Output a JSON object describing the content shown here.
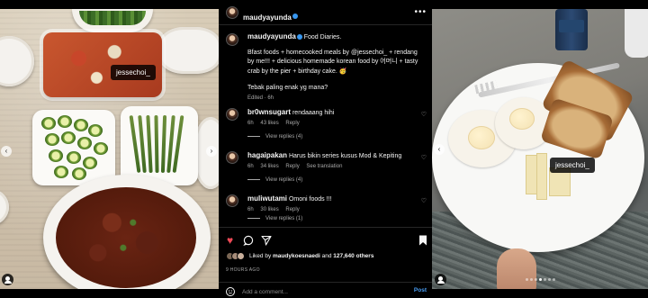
{
  "post": {
    "author": "maudyayunda",
    "caption_author": "maudyayunda",
    "caption_title": "Food Diaries.",
    "caption_body_1": "Bfast foods + homecooked meals by @jessechoi_ + rendang by me!!! + delicious homemade korean food by 어머니 + tasty crab by the pier + birthday cake. 🥳",
    "caption_body_2": "Tebak paling enak yg mana?",
    "caption_edited": "Edited · 6h",
    "more_icon": "•••"
  },
  "left_photo": {
    "tag": "jessechoi_",
    "prev_arrow": "‹",
    "next_arrow": "›"
  },
  "right_photo": {
    "tag": "jessechoi_",
    "prev_arrow": "‹"
  },
  "comments": [
    {
      "user": "br0wnsugart",
      "text": "rendaaang hihi",
      "time": "6h",
      "likes": "43 likes",
      "reply": "Reply",
      "replies": "View replies (4)"
    },
    {
      "user": "hagaipakan",
      "text": "Harus bikin series kusus Mod & Kepiting",
      "time": "6h",
      "likes": "34 likes",
      "reply": "Reply",
      "translation": "See translation",
      "replies": "View replies (4)"
    },
    {
      "user": "muliwutami",
      "text": "Omoni foods !!!",
      "time": "6h",
      "likes": "30 likes",
      "reply": "Reply",
      "replies": "View replies (1)"
    }
  ],
  "likes": {
    "prefix": "Liked by",
    "user": "maudykoesnaedi",
    "middle": "and",
    "count": "127,640 others"
  },
  "time_ago": "9 HOURS AGO",
  "add_comment": {
    "placeholder": "Add a comment...",
    "post_label": "Post"
  },
  "colors": {
    "accent": "#3897f0",
    "like": "#ed4956",
    "background": "#000000",
    "post_link": "#4a9ff5"
  }
}
